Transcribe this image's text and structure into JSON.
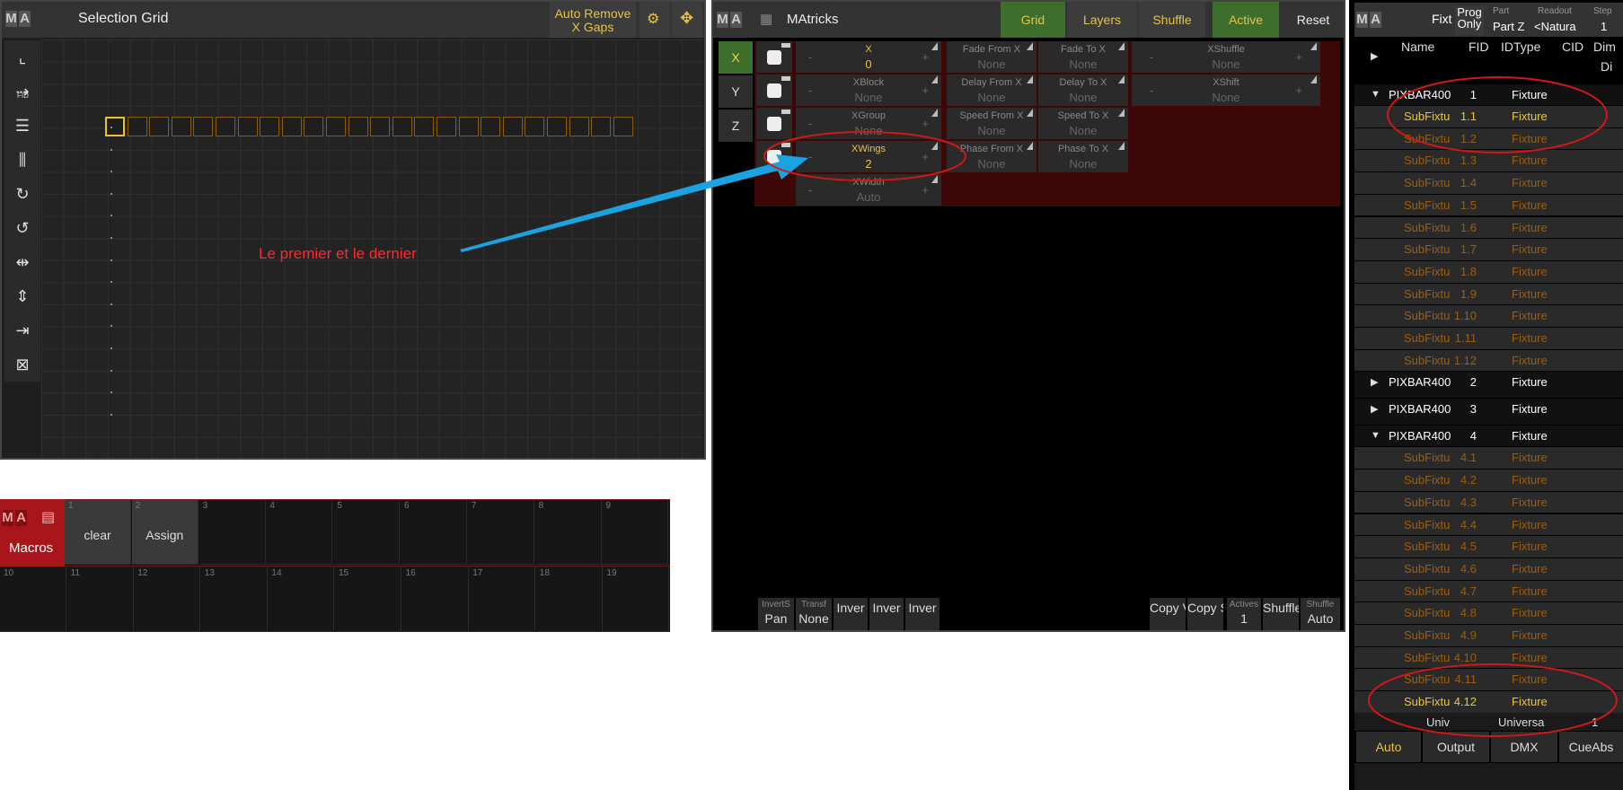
{
  "selection_grid": {
    "title": "Selection Grid",
    "auto_remove_label": "Auto Remove\nX Gaps",
    "icon_buttons": [
      "fixture-sheet-icon",
      "move-icon"
    ],
    "tools": [
      "select-tool-icon",
      "fid-order-icon",
      "rows-icon",
      "columns-icon",
      "rotate-cw-icon",
      "rotate-ccw-icon",
      "mirror-h-icon",
      "mirror-v-icon",
      "shrink-icon",
      "fit-icon"
    ],
    "fid_label": "FID",
    "cells_count": 24,
    "annotation": "Le premier et le dernier"
  },
  "macros": {
    "title": "Macros",
    "items": [
      {
        "n": "1",
        "label": "clear"
      },
      {
        "n": "2",
        "label": "Assign"
      },
      {
        "n": "3",
        "label": ""
      },
      {
        "n": "4",
        "label": ""
      },
      {
        "n": "5",
        "label": ""
      },
      {
        "n": "6",
        "label": ""
      },
      {
        "n": "7",
        "label": ""
      },
      {
        "n": "8",
        "label": ""
      },
      {
        "n": "9",
        "label": ""
      }
    ],
    "row2": [
      "10",
      "11",
      "12",
      "13",
      "14",
      "15",
      "16",
      "17",
      "18",
      "19"
    ]
  },
  "matricks": {
    "title": "MAtricks",
    "tabs": [
      "Grid",
      "Layers",
      "Shuffle",
      "Active",
      "Reset"
    ],
    "axes": [
      "X",
      "Y",
      "Z"
    ],
    "rows": [
      {
        "label": "X",
        "value": "0",
        "highlight": true
      },
      {
        "label": "XBlock",
        "value": "None",
        "highlight": false
      },
      {
        "label": "XGroup",
        "value": "None",
        "highlight": false
      },
      {
        "label": "XWings",
        "value": "2",
        "highlight": true
      },
      {
        "label": "XWidth",
        "value": "Auto",
        "highlight": false
      }
    ],
    "fade": [
      {
        "from": "Fade From X",
        "to": "Fade To X"
      },
      {
        "from": "Delay From X",
        "to": "Delay To X"
      },
      {
        "from": "Speed From X",
        "to": "Speed To X"
      },
      {
        "from": "Phase From X",
        "to": "Phase To X"
      }
    ],
    "none": "None",
    "shuffle": [
      {
        "label": "XShuffle",
        "value": "None"
      },
      {
        "label": "XShift",
        "value": "None"
      }
    ],
    "bottom": [
      {
        "s": "InvertS",
        "b": "Pan"
      },
      {
        "s": "Transf",
        "b": "None"
      },
      {
        "s": "",
        "b": "Inver"
      },
      {
        "s": "",
        "b": "Inver"
      },
      {
        "s": "",
        "b": "Inver"
      },
      {
        "s": "",
        "b": "Copy Values"
      },
      {
        "s": "",
        "b": "Copy Sel"
      },
      {
        "s": "Actives",
        "b": "1"
      },
      {
        "s": "",
        "b": "Shuffle"
      },
      {
        "s": "Shuffle",
        "b": "Auto"
      }
    ]
  },
  "fixtures": {
    "title": "Fixt",
    "prog_only": "Prog\nOnly",
    "part_label": "Part",
    "part_value": "Part Z",
    "readout_label": "Readout",
    "readout_value": "<Natura",
    "step_label": "Step",
    "step_value": "1",
    "columns": [
      "Name",
      "FID",
      "IDType",
      "CID",
      "Dim",
      "Di"
    ],
    "rows": [
      {
        "kind": "main",
        "name": "PIXBAR400",
        "fid": "1",
        "type": "Fixture",
        "open": true
      },
      {
        "kind": "sub",
        "name": "SubFixtu",
        "fid": "1.1",
        "type": "Fixture",
        "sel": true
      },
      {
        "kind": "sub",
        "name": "SubFixtu",
        "fid": "1.2",
        "type": "Fixture"
      },
      {
        "kind": "sub",
        "name": "SubFixtu",
        "fid": "1.3",
        "type": "Fixture"
      },
      {
        "kind": "sub",
        "name": "SubFixtu",
        "fid": "1.4",
        "type": "Fixture"
      },
      {
        "kind": "sub",
        "name": "SubFixtu",
        "fid": "1.5",
        "type": "Fixture"
      },
      {
        "kind": "sub",
        "name": "SubFixtu",
        "fid": "1.6",
        "type": "Fixture"
      },
      {
        "kind": "sub",
        "name": "SubFixtu",
        "fid": "1.7",
        "type": "Fixture"
      },
      {
        "kind": "sub",
        "name": "SubFixtu",
        "fid": "1.8",
        "type": "Fixture"
      },
      {
        "kind": "sub",
        "name": "SubFixtu",
        "fid": "1.9",
        "type": "Fixture"
      },
      {
        "kind": "sub",
        "name": "SubFixtu",
        "fid": "1.10",
        "type": "Fixture"
      },
      {
        "kind": "sub",
        "name": "SubFixtu",
        "fid": "1.11",
        "type": "Fixture"
      },
      {
        "kind": "sub",
        "name": "SubFixtu",
        "fid": "1.12",
        "type": "Fixture"
      },
      {
        "kind": "main",
        "name": "PIXBAR400",
        "fid": "2",
        "type": "Fixture",
        "open": false
      },
      {
        "kind": "main",
        "name": "PIXBAR400",
        "fid": "3",
        "type": "Fixture",
        "open": false
      },
      {
        "kind": "main",
        "name": "PIXBAR400",
        "fid": "4",
        "type": "Fixture",
        "open": true
      },
      {
        "kind": "sub",
        "name": "SubFixtu",
        "fid": "4.1",
        "type": "Fixture"
      },
      {
        "kind": "sub",
        "name": "SubFixtu",
        "fid": "4.2",
        "type": "Fixture"
      },
      {
        "kind": "sub",
        "name": "SubFixtu",
        "fid": "4.3",
        "type": "Fixture"
      },
      {
        "kind": "sub",
        "name": "SubFixtu",
        "fid": "4.4",
        "type": "Fixture"
      },
      {
        "kind": "sub",
        "name": "SubFixtu",
        "fid": "4.5",
        "type": "Fixture"
      },
      {
        "kind": "sub",
        "name": "SubFixtu",
        "fid": "4.6",
        "type": "Fixture"
      },
      {
        "kind": "sub",
        "name": "SubFixtu",
        "fid": "4.7",
        "type": "Fixture"
      },
      {
        "kind": "sub",
        "name": "SubFixtu",
        "fid": "4.8",
        "type": "Fixture"
      },
      {
        "kind": "sub",
        "name": "SubFixtu",
        "fid": "4.9",
        "type": "Fixture"
      },
      {
        "kind": "sub",
        "name": "SubFixtu",
        "fid": "4.10",
        "type": "Fixture"
      },
      {
        "kind": "sub",
        "name": "SubFixtu",
        "fid": "4.11",
        "type": "Fixture"
      },
      {
        "kind": "sub",
        "name": "SubFixtu",
        "fid": "4.12",
        "type": "Fixture",
        "sel": true
      }
    ],
    "univ_label": "Univ",
    "universe_label": "Universa",
    "universe_value": "1",
    "buttons": [
      "Auto",
      "Output",
      "DMX",
      "CueAbs"
    ]
  },
  "colors": {
    "accent": "#e5c34a",
    "annotation": "#ff2a2a",
    "arrow": "#1aa3e0",
    "macro_red": "#a8151a",
    "grid_green": "#3e6e2c"
  }
}
